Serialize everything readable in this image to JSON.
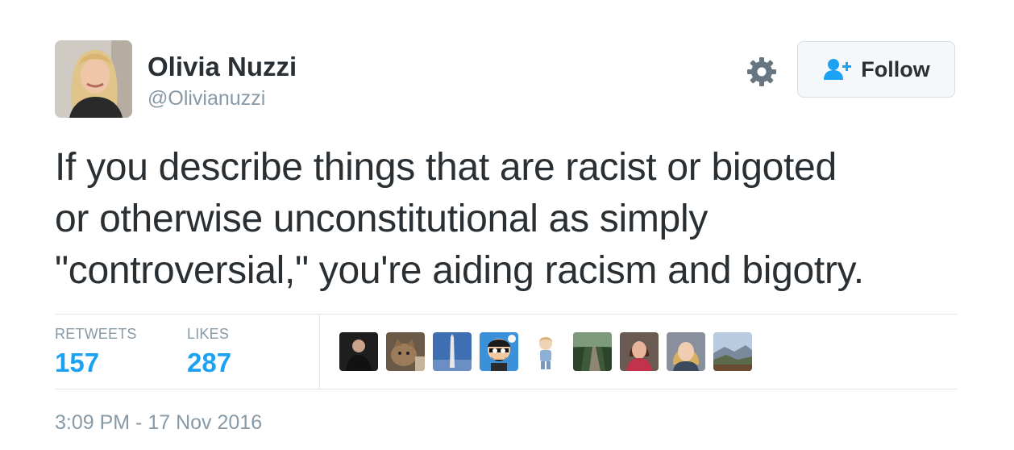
{
  "author": {
    "display_name": "Olivia Nuzzi",
    "handle": "@Olivianuzzi",
    "avatar_icon": "profile-photo"
  },
  "actions": {
    "settings_icon": "gear-icon",
    "follow_label": "Follow",
    "follow_icon": "add-user-icon",
    "accent_color": "#1da1f2"
  },
  "tweet": {
    "text_lines": [
      "If you describe things that are racist or bigoted",
      "or otherwise unconstitutional as simply",
      "\"controversial,\" you're aiding racism and bigotry."
    ]
  },
  "stats": {
    "retweets_label": "RETWEETS",
    "retweets_count": "157",
    "likes_label": "LIKES",
    "likes_count": "287"
  },
  "likers": [
    "liker-avatar-man-dark",
    "liker-avatar-cat",
    "liker-avatar-monument",
    "liker-avatar-cartoon",
    "liker-avatar-figurine",
    "liker-avatar-trail",
    "liker-avatar-woman-red",
    "liker-avatar-woman-blonde",
    "liker-avatar-landscape"
  ],
  "timestamp": "3:09 PM - 17 Nov 2016"
}
